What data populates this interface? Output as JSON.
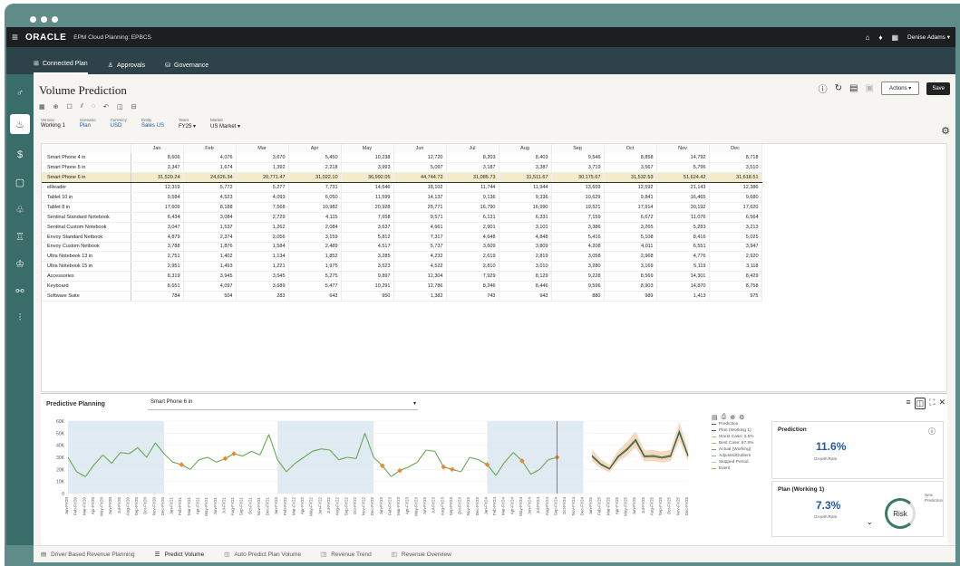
{
  "app": {
    "logo": "ORACLE",
    "title": "EPM Cloud Planning: EPBCS",
    "user": "Denise Adams ▾"
  },
  "nav": {
    "items": [
      {
        "label": "Connected Plan",
        "icon": "plan-icon"
      },
      {
        "label": "Approvals",
        "icon": "approvals-icon"
      },
      {
        "label": "Governance",
        "icon": "governance-icon"
      }
    ]
  },
  "page": {
    "title": "Volume Prediction",
    "actions_label": "Actions ▾",
    "save_label": "Save"
  },
  "pov": [
    {
      "label": "Version",
      "value": "Working 1",
      "blue": false
    },
    {
      "label": "Scenario",
      "value": "Plan",
      "blue": true
    },
    {
      "label": "Currency",
      "value": "USD",
      "blue": true
    },
    {
      "label": "Entity",
      "value": "Sales US",
      "blue": true
    },
    {
      "label": "Years",
      "value": "FY25 ▾",
      "blue": false
    },
    {
      "label": "Market",
      "value": "US Market ▾",
      "blue": false
    }
  ],
  "grid": {
    "months": [
      "Jan",
      "Feb",
      "Mar",
      "Apr",
      "May",
      "Jun",
      "Jul",
      "Aug",
      "Sep",
      "Oct",
      "Nov",
      "Dec"
    ],
    "rows": [
      {
        "name": "Smart Phone 4 in",
        "v": [
          "8,606",
          "4,076",
          "3,670",
          "5,450",
          "10,238",
          "12,720",
          "8,203",
          "8,403",
          "9,546",
          "8,858",
          "14,792",
          "8,718"
        ]
      },
      {
        "name": "Smart Phone 5 in",
        "v": [
          "3,347",
          "1,674",
          "1,392",
          "2,218",
          "3,993",
          "5,097",
          "3,187",
          "3,387",
          "3,719",
          "3,567",
          "5,796",
          "3,510"
        ]
      },
      {
        "name": "Smart Phone 6 in",
        "v": [
          "31,520.24",
          "24,626.34",
          "20,771.47",
          "31,022.10",
          "36,992.05",
          "44,744.72",
          "31,085.73",
          "31,511.67",
          "30,175.67",
          "31,532.53",
          "51,624.42",
          "31,618.51"
        ],
        "hl": true
      },
      {
        "name": "eReader",
        "v": [
          "12,319",
          "5,772",
          "5,277",
          "7,731",
          "14,646",
          "18,102",
          "11,744",
          "11,944",
          "13,659",
          "12,592",
          "21,143",
          "12,386"
        ]
      },
      {
        "name": "Tablet 10 in",
        "v": [
          "9,584",
          "4,523",
          "4,093",
          "6,050",
          "11,599",
          "14,137",
          "9,136",
          "9,336",
          "10,629",
          "9,841",
          "16,465",
          "9,680"
        ]
      },
      {
        "name": "Tablet 8 in",
        "v": [
          "17,609",
          "8,188",
          "7,568",
          "10,982",
          "20,928",
          "25,771",
          "16,790",
          "16,990",
          "19,521",
          "17,914",
          "30,192",
          "17,620"
        ]
      },
      {
        "name": "Sentinal Standard Notebook",
        "v": [
          "6,434",
          "3,084",
          "2,729",
          "4,115",
          "7,658",
          "9,571",
          "6,131",
          "6,331",
          "7,159",
          "6,672",
          "11,076",
          "6,564"
        ]
      },
      {
        "name": "Sentinal Custom Notebook",
        "v": [
          "3,047",
          "1,537",
          "1,262",
          "2,084",
          "3,637",
          "4,661",
          "2,901",
          "3,101",
          "3,386",
          "3,265",
          "5,283",
          "3,213"
        ]
      },
      {
        "name": "Envoy Standard Netbook",
        "v": [
          "4,879",
          "2,374",
          "2,056",
          "3,159",
          "5,812",
          "7,317",
          "4,648",
          "4,848",
          "5,416",
          "5,108",
          "8,416",
          "5,025"
        ]
      },
      {
        "name": "Envoy Custom Netbook",
        "v": [
          "3,788",
          "1,876",
          "1,584",
          "2,489",
          "4,517",
          "5,737",
          "3,609",
          "3,809",
          "4,208",
          "4,011",
          "6,551",
          "3,947"
        ]
      },
      {
        "name": "Ultra Notebook 13 in",
        "v": [
          "2,751",
          "1,402",
          "1,134",
          "1,852",
          "3,285",
          "4,232",
          "2,619",
          "2,819",
          "3,058",
          "2,968",
          "4,776",
          "2,920"
        ]
      },
      {
        "name": "Ultra Notebook 15 in",
        "v": [
          "2,951",
          "1,493",
          "1,221",
          "1,975",
          "3,523",
          "4,522",
          "2,810",
          "3,010",
          "3,280",
          "3,169",
          "5,119",
          "3,118"
        ]
      },
      {
        "name": "Accessories",
        "v": [
          "8,319",
          "3,945",
          "3,545",
          "5,275",
          "9,897",
          "12,304",
          "7,929",
          "8,129",
          "9,228",
          "8,569",
          "14,301",
          "8,429"
        ]
      },
      {
        "name": "Keyboard",
        "v": [
          "8,651",
          "4,097",
          "3,689",
          "5,477",
          "10,291",
          "12,786",
          "8,246",
          "8,446",
          "9,596",
          "8,903",
          "14,870",
          "8,758"
        ]
      },
      {
        "name": "Software Suite",
        "v": [
          "784",
          "504",
          "283",
          "643",
          "950",
          "1,382",
          "743",
          "943",
          "880",
          "989",
          "1,413",
          "975"
        ]
      }
    ]
  },
  "predictive": {
    "title": "Predictive Planning",
    "member": "Smart Phone 6 in",
    "legend": [
      "Prediction",
      "Plan (Working 1)",
      "Worst Case: 2.5%",
      "Best Case: 97.5%",
      "Actual (Working)",
      "AdjustedOutliers",
      "Skipped Period",
      "Event"
    ],
    "legend_colors": [
      "#2b7a2b",
      "#555555",
      "#e8a060",
      "#e8a060",
      "#6aa84f",
      "#7fb0d8",
      "#bbbbbb",
      "#e8893a"
    ]
  },
  "chart_data": {
    "type": "line",
    "y_ticks": [
      "60K",
      "50K",
      "40K",
      "30K",
      "20K",
      "10K",
      "0"
    ],
    "ylim": [
      0,
      60000
    ],
    "x_labels": [
      "Jan-FY20",
      "Feb-FY20",
      "Mar-FY20",
      "Apr-FY20",
      "May-FY20",
      "Jun-FY20",
      "Jul-FY20",
      "Aug-FY20",
      "Sep-FY20",
      "Oct-FY20",
      "Nov-FY20",
      "Dec-FY20",
      "Jan-FY21",
      "Feb-FY21",
      "Mar-FY21",
      "Apr-FY21",
      "May-FY21",
      "Jun-FY21",
      "Jul-FY21",
      "Aug-FY21",
      "Sep-FY21",
      "Oct-FY21",
      "Nov-FY21",
      "Dec-FY21",
      "Jan-FY22",
      "Feb-FY22",
      "Mar-FY22",
      "Apr-FY22",
      "May-FY22",
      "Jun-FY22",
      "Jul-FY22",
      "Aug-FY22",
      "Sep-FY22",
      "Oct-FY22",
      "Nov-FY22",
      "Dec-FY22",
      "Jan-FY23",
      "Feb-FY23",
      "Mar-FY23",
      "Apr-FY23",
      "May-FY23",
      "Jun-FY23",
      "Jul-FY23",
      "Aug-FY23",
      "Sep-FY23",
      "Oct-FY23",
      "Nov-FY23",
      "Dec-FY23",
      "Jan-FY24",
      "Feb-FY24",
      "Mar-FY24",
      "Apr-FY24",
      "May-FY24",
      "Jun-FY24",
      "Jul-FY24",
      "Aug-FY24",
      "Sep-FY24",
      "Oct-FY24",
      "Nov-FY24",
      "Dec-FY24",
      "Jan-FY25",
      "Feb-FY25",
      "Mar-FY25",
      "Apr-FY25",
      "May-FY25",
      "Jun-FY25",
      "Jul-FY25",
      "Aug-FY25",
      "Sep-FY25",
      "Oct-FY25",
      "Nov-FY25",
      "Dec-FY25"
    ],
    "actual": [
      30000,
      18000,
      14000,
      24000,
      32000,
      25000,
      34000,
      33000,
      38000,
      30000,
      42000,
      33000,
      26000,
      24000,
      20000,
      28000,
      30000,
      26000,
      29000,
      33000,
      31000,
      35000,
      32000,
      49000,
      28000,
      18000,
      25000,
      30000,
      35000,
      37000,
      36000,
      28000,
      30000,
      29000,
      50000,
      30000,
      23000,
      14000,
      19000,
      22000,
      26000,
      36000,
      35000,
      22000,
      20000,
      18000,
      30000,
      28000,
      24000,
      15000,
      26000,
      34000,
      27000,
      16000,
      20000,
      28000,
      30000
    ],
    "forecast": [
      31520,
      24626,
      20771,
      31022,
      36992,
      44745,
      31086,
      31512,
      30176,
      31533,
      51624,
      31619
    ],
    "shaded_year_ranges": [
      [
        0,
        11
      ],
      [
        24,
        35
      ],
      [
        48,
        59
      ]
    ],
    "events": [
      13,
      18,
      19,
      36,
      38,
      43,
      44,
      48,
      52,
      56
    ]
  },
  "prediction_card": {
    "title": "Prediction",
    "value": "11.6%",
    "sub": "Growth Rate"
  },
  "plan_card": {
    "title": "Plan (Working 1)",
    "value": "7.3%",
    "sub": "Growth Rate",
    "risk": "Risk",
    "new_prediction": "New Prediction"
  },
  "bottom_tabs": [
    {
      "label": "Driver Based Revenue Planning",
      "active": false
    },
    {
      "label": "Predict Volume",
      "active": true
    },
    {
      "label": "Auto Predict Plan Volume",
      "active": false
    },
    {
      "label": "Revenue Trend",
      "active": false
    },
    {
      "label": "Revenue Overview",
      "active": false
    }
  ]
}
